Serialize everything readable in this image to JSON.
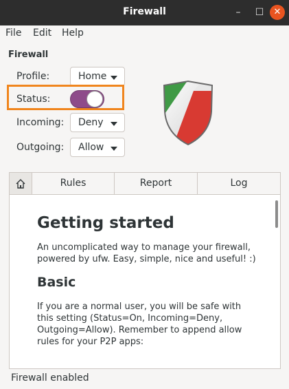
{
  "window": {
    "title": "Firewall",
    "minimize": "–",
    "maximize": "☐",
    "close": "✕"
  },
  "menubar": [
    "File",
    "Edit",
    "Help"
  ],
  "section_title": "Firewall",
  "profile": {
    "label": "Profile:",
    "value": "Home"
  },
  "status": {
    "label": "Status:",
    "enabled": true
  },
  "incoming": {
    "label": "Incoming:",
    "value": "Deny"
  },
  "outgoing": {
    "label": "Outgoing:",
    "value": "Allow"
  },
  "tabs": {
    "home_icon": "home-icon",
    "rules": "Rules",
    "report": "Report",
    "log": "Log"
  },
  "doc": {
    "title": "Getting started",
    "intro": "An uncomplicated way to manage your firewall, powered by ufw. Easy, simple, nice and useful! :)",
    "basic_heading": "Basic",
    "basic_text": "If you are a normal user, you will be safe with this setting (Status=On, Incoming=Deny, Outgoing=Allow). Remember to append allow rules for your P2P apps:"
  },
  "statusbar": "Firewall enabled",
  "colors": {
    "accent": "#8e4b8a",
    "highlight": "#f0851d",
    "close": "#e95420"
  }
}
